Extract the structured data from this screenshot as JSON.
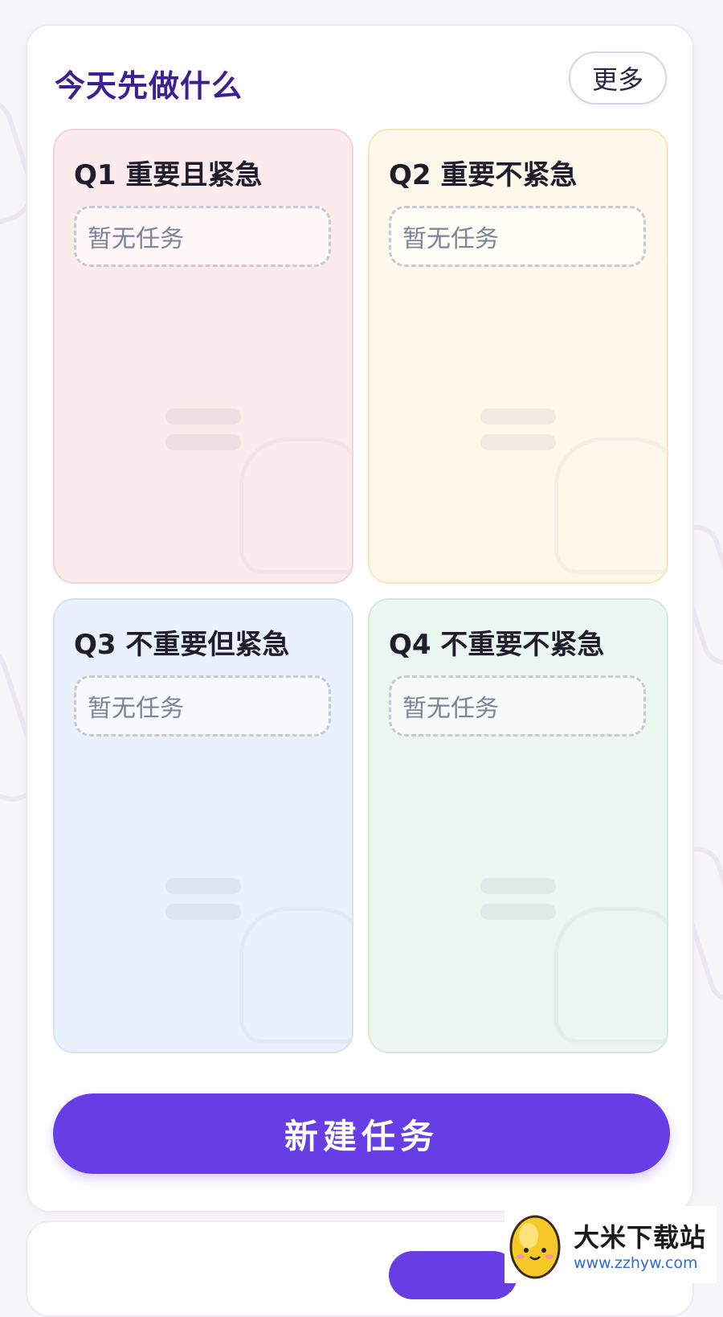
{
  "card": {
    "title": "今天先做什么",
    "more_label": "更多"
  },
  "quadrants": [
    {
      "title": "Q1 重要且紧急",
      "empty_text": "暂无任务",
      "color": "#fcebed"
    },
    {
      "title": "Q2 重要不紧急",
      "empty_text": "暂无任务",
      "color": "#fdf8e9"
    },
    {
      "title": "Q3 不重要但紧急",
      "empty_text": "暂无任务",
      "color": "#eaf1fc"
    },
    {
      "title": "Q4 不重要不紧急",
      "empty_text": "暂无任务",
      "color": "#eaf6ef"
    }
  ],
  "new_task_label": "新建任务",
  "accent_color": "#673de6",
  "title_color": "#3d1e93",
  "watermark": {
    "name": "大米下载站",
    "url": "www.zzhyw.com",
    "logo_icon": "corn-mascot-icon"
  }
}
